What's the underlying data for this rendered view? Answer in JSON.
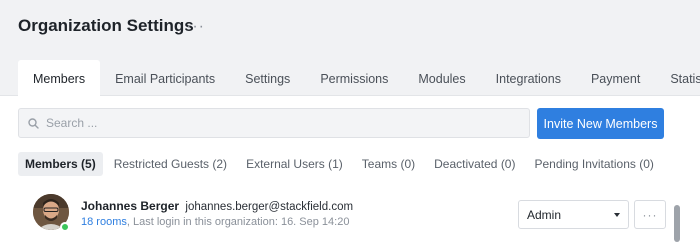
{
  "page": {
    "title": "Organization Settings",
    "more_glyph": "···"
  },
  "tabs": [
    {
      "label": "Members",
      "active": true
    },
    {
      "label": "Email Participants"
    },
    {
      "label": "Settings"
    },
    {
      "label": "Permissions"
    },
    {
      "label": "Modules"
    },
    {
      "label": "Integrations"
    },
    {
      "label": "Payment"
    },
    {
      "label": "Statistics"
    }
  ],
  "search": {
    "placeholder": "Search ...",
    "value": ""
  },
  "actions": {
    "invite_label": "Invite New Members"
  },
  "subtabs": [
    {
      "label": "Members (5)",
      "active": true
    },
    {
      "label": "Restricted Guests (2)"
    },
    {
      "label": "External Users (1)"
    },
    {
      "label": "Teams (0)"
    },
    {
      "label": "Deactivated (0)"
    },
    {
      "label": "Pending Invitations (0)"
    }
  ],
  "members": [
    {
      "name": "Johannes Berger",
      "email": "johannes.berger@stackfield.com",
      "rooms": "18 rooms",
      "last_login": ", Last login in this organization: 16. Sep 14:20",
      "role": "Admin",
      "online": true
    }
  ],
  "colors": {
    "accent": "#2f7fe0",
    "header_bg": "#f1f2f4",
    "online": "#3cc55a"
  },
  "icons": {
    "search": "search-icon",
    "more": "more-horizontal-icon",
    "caret": "chevron-down-icon"
  }
}
